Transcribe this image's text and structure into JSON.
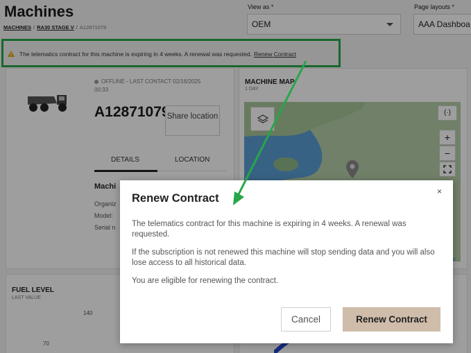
{
  "header": {
    "title": "Machines",
    "breadcrumb": [
      "MACHINES",
      "RA30 STAGE V",
      "A12871079"
    ]
  },
  "view_as": {
    "label": "View as *",
    "value": "OEM"
  },
  "page_layouts": {
    "label": "Page layouts *",
    "value": "AAA Dashboa"
  },
  "notice": {
    "text": "The telematics contract for this machine is expiring in 4 weeks. A renewal was requested.",
    "link": "Renew Contract"
  },
  "machine": {
    "status": "OFFLINE - LAST CONTACT 02/16/2025",
    "time": "00:33",
    "id": "A12871079",
    "share_label": "Share location",
    "tabs": [
      "DETAILS",
      "LOCATION"
    ],
    "details_head": "Machi",
    "details_rows": [
      "Organiz",
      "Model:",
      "Serial n"
    ]
  },
  "map": {
    "title": "MACHINE MAP",
    "subtitle": "1 DAY",
    "locate_glyph": "(·)",
    "zoom_in": "+",
    "zoom_out": "−",
    "attribution": "p"
  },
  "fuel": {
    "title": "FUEL LEVEL",
    "subtitle": "LAST VALUE",
    "tick_140": "140",
    "tick_70": "70"
  },
  "modal": {
    "title": "Renew Contract",
    "close": "×",
    "paragraph1": "The telematics contract for this machine is expiring in 4 weeks. A renewal was requested.",
    "paragraph2": "If the subscription is not renewed this machine will stop sending data and you will also lose access to all historical data.",
    "paragraph3": "You are eligible for renewing the contract.",
    "cancel_label": "Cancel",
    "renew_label": "Renew Contract"
  },
  "colors": {
    "highlight": "#27a64a",
    "renew_button": "#cfbcaa",
    "map_water": "#5b9fd4"
  }
}
